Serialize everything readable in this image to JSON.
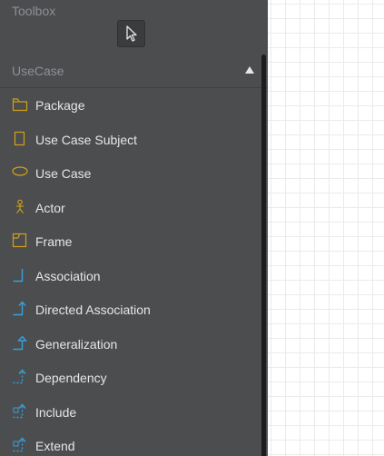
{
  "toolbox": {
    "title": "Toolbox",
    "pointer_icon": "cursor-arrow-icon"
  },
  "section": {
    "title": "UseCase",
    "collapse_icon": "triangle-up-icon"
  },
  "items": [
    {
      "label": "Package",
      "icon": "package-icon"
    },
    {
      "label": "Use Case Subject",
      "icon": "use-case-subject-icon"
    },
    {
      "label": "Use Case",
      "icon": "use-case-icon"
    },
    {
      "label": "Actor",
      "icon": "actor-icon"
    },
    {
      "label": "Frame",
      "icon": "frame-icon"
    },
    {
      "label": "Association",
      "icon": "association-icon"
    },
    {
      "label": "Directed Association",
      "icon": "directed-association-icon"
    },
    {
      "label": "Generalization",
      "icon": "generalization-icon"
    },
    {
      "label": "Dependency",
      "icon": "dependency-icon"
    },
    {
      "label": "Include",
      "icon": "include-icon"
    },
    {
      "label": "Extend",
      "icon": "extend-icon"
    }
  ],
  "colors": {
    "panel_bg": "#4b4d4f",
    "label_text": "#e6e6e6",
    "muted_text": "#8d9094",
    "shape_icon": "#d4a017",
    "relation_icon": "#3a9fd8"
  }
}
